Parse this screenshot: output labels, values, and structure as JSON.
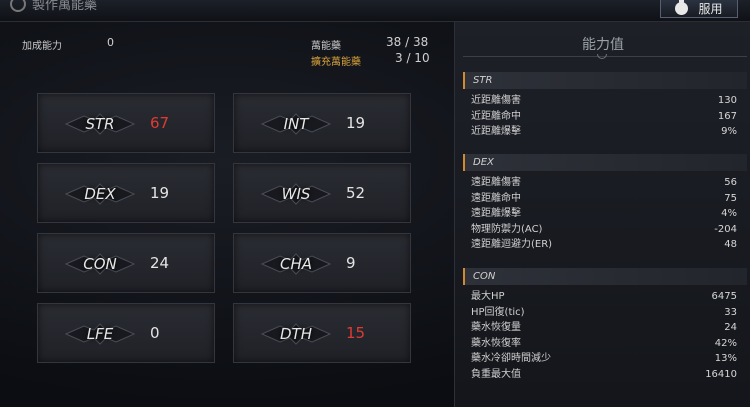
{
  "window": {
    "title": "製作萬能藥",
    "use_button_label": "服用",
    "use_icon": "potion-icon"
  },
  "summary": {
    "bonus_label": "加成能力",
    "bonus_value": "0",
    "elixir_label": "萬能藥",
    "elixir_value": "38 / 38",
    "extra_label": "擴充萬能藥",
    "extra_value": "3 / 10"
  },
  "stats": [
    {
      "name": "STR",
      "value": "67",
      "highlight": true
    },
    {
      "name": "INT",
      "value": "19",
      "highlight": false
    },
    {
      "name": "DEX",
      "value": "19",
      "highlight": false
    },
    {
      "name": "WIS",
      "value": "52",
      "highlight": false
    },
    {
      "name": "CON",
      "value": "24",
      "highlight": false
    },
    {
      "name": "CHA",
      "value": "9",
      "highlight": false
    },
    {
      "name": "LFE",
      "value": "0",
      "highlight": false
    },
    {
      "name": "DTH",
      "value": "15",
      "highlight": true
    }
  ],
  "panel": {
    "title": "能力值",
    "sections": [
      {
        "name": "STR",
        "rows": [
          {
            "label": "近距離傷害",
            "value": "130"
          },
          {
            "label": "近距離命中",
            "value": "167"
          },
          {
            "label": "近距離爆擊",
            "value": "9%"
          }
        ]
      },
      {
        "name": "DEX",
        "rows": [
          {
            "label": "遠距離傷害",
            "value": "56"
          },
          {
            "label": "遠距離命中",
            "value": "75"
          },
          {
            "label": "遠距離爆擊",
            "value": "4%"
          },
          {
            "label": "物理防禦力(AC)",
            "value": "-204"
          },
          {
            "label": "遠距離迴避力(ER)",
            "value": "48"
          }
        ]
      },
      {
        "name": "CON",
        "rows": [
          {
            "label": "最大HP",
            "value": "6475"
          },
          {
            "label": "HP回復(tic)",
            "value": "33"
          },
          {
            "label": "藥水恢復量",
            "value": "24"
          },
          {
            "label": "藥水恢復率",
            "value": "42%"
          },
          {
            "label": "藥水冷卻時間減少",
            "value": "13%"
          },
          {
            "label": "負重最大值",
            "value": "16410"
          }
        ]
      }
    ]
  },
  "colors": {
    "accent": "#d38a2c",
    "highlight_red": "#e03b33",
    "extra_label": "#d8a23a"
  }
}
